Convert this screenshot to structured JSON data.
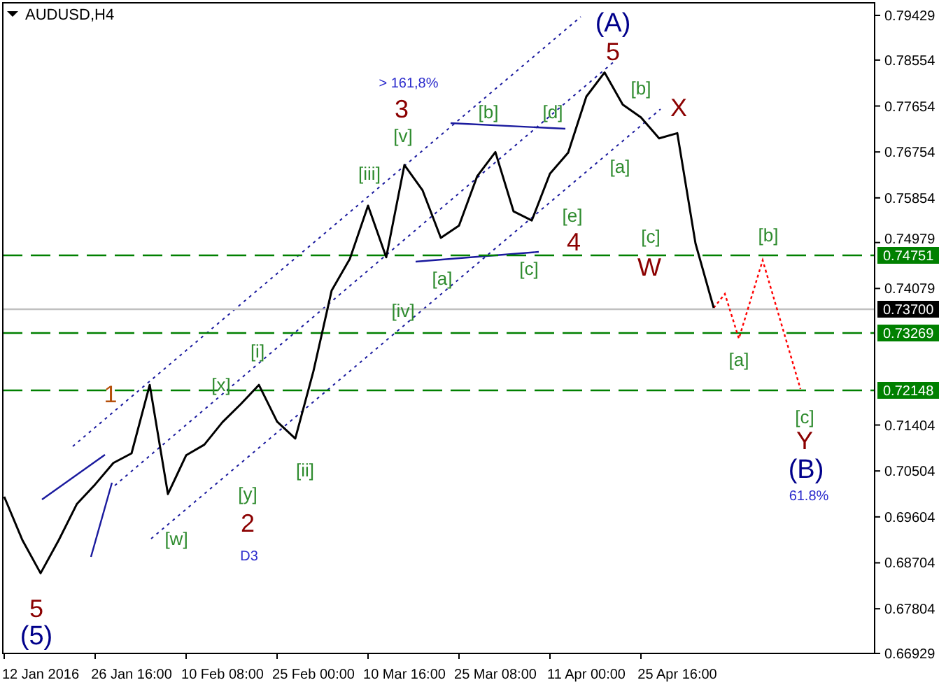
{
  "chart_data": {
    "type": "line",
    "title": "AUDUSD,H4",
    "ylim": [
      0.66929,
      0.79676
    ],
    "categories": [
      null,
      null,
      "12 Jan 2016",
      null,
      null,
      null,
      null,
      "26 Jan 16:00",
      null,
      null,
      null,
      null,
      "10 Feb 08:00",
      null,
      null,
      null,
      null,
      "25 Feb 00:00",
      null,
      null,
      null,
      null,
      "10 Mar 16:00",
      null,
      null,
      null,
      null,
      "25 Mar 08:00",
      null,
      null,
      null,
      null,
      "11 Apr 00:00",
      null,
      null,
      null,
      null,
      "25 Apr 16:00",
      null,
      null,
      null,
      null,
      null,
      null,
      null,
      null,
      null,
      null
    ],
    "series": [
      {
        "color": "#000000",
        "values": [
          0.7,
          0.6915,
          0.685,
          0.6915,
          0.6986,
          0.7024,
          0.7066,
          0.7085,
          0.7219,
          0.7005,
          0.7081,
          0.7102,
          0.7146,
          0.7181,
          0.7219,
          0.7147,
          0.7114,
          0.7246,
          0.7404,
          0.7466,
          0.757,
          0.7469,
          0.765,
          0.76,
          0.7507,
          0.7531,
          0.7628,
          0.7675,
          0.7559,
          0.7541,
          0.7633,
          0.7674,
          0.7784,
          0.7831,
          0.7768,
          0.7743,
          0.7702,
          0.7712,
          0.7496,
          0.737,
          null,
          null,
          null,
          null,
          null,
          null,
          null,
          null
        ]
      }
    ],
    "yticks": [
      {
        "value": 0.79429,
        "label": "0.79429"
      },
      {
        "value": 0.78554,
        "label": "0.78554"
      },
      {
        "value": 0.77654,
        "label": "0.77654"
      },
      {
        "value": 0.76754,
        "label": "0.76754"
      },
      {
        "value": 0.75854,
        "label": "0.75854"
      },
      {
        "value": 0.74979,
        "label": "0.74979"
      },
      {
        "value": 0.74079,
        "label": "0.74079"
      },
      {
        "value": 0.71404,
        "label": "0.71404"
      },
      {
        "value": 0.70504,
        "label": "0.70504"
      },
      {
        "value": 0.69604,
        "label": "0.69604"
      },
      {
        "value": 0.68704,
        "label": "0.68704"
      },
      {
        "value": 0.67804,
        "label": "0.67804"
      },
      {
        "value": 0.66929,
        "label": "0.66929"
      }
    ]
  },
  "price_levels": [
    {
      "kind": "level",
      "label": "0.74751"
    },
    {
      "kind": "current",
      "label": "0.73700"
    },
    {
      "kind": "level",
      "label": "0.73269"
    },
    {
      "kind": "level",
      "label": "0.72148"
    }
  ],
  "wave_labels": [
    {
      "kind": "degree",
      "text": "(A)"
    },
    {
      "kind": "major",
      "text": "5"
    },
    {
      "kind": "note",
      "text": "> 161,8%"
    },
    {
      "kind": "minor",
      "text": "[b]"
    },
    {
      "kind": "major",
      "text": "3"
    },
    {
      "kind": "minor",
      "text": "[b]"
    },
    {
      "kind": "minor",
      "text": "[d]"
    },
    {
      "kind": "major",
      "text": "X"
    },
    {
      "kind": "minor",
      "text": "[v]"
    },
    {
      "kind": "minor",
      "text": "[iii]"
    },
    {
      "kind": "minor",
      "text": "[a]"
    },
    {
      "kind": "minor",
      "text": "[e]"
    },
    {
      "kind": "major",
      "text": "4"
    },
    {
      "kind": "minor",
      "text": "[c]"
    },
    {
      "kind": "minor",
      "text": "[b]"
    },
    {
      "kind": "minor",
      "text": "[a]"
    },
    {
      "kind": "minor",
      "text": "[c]"
    },
    {
      "kind": "major",
      "text": "W"
    },
    {
      "kind": "minor",
      "text": "[iv]"
    },
    {
      "kind": "minor",
      "text": "[i]"
    },
    {
      "kind": "minor",
      "text": "[a]"
    },
    {
      "kind": "intermediate",
      "text": "1"
    },
    {
      "kind": "minor",
      "text": "[x]"
    },
    {
      "kind": "minor",
      "text": "[c]"
    },
    {
      "kind": "major",
      "text": "Y"
    },
    {
      "kind": "minor",
      "text": "[ii]"
    },
    {
      "kind": "degree",
      "text": "(B)"
    },
    {
      "kind": "minor",
      "text": "[y]"
    },
    {
      "kind": "note",
      "text": "61.8%"
    },
    {
      "kind": "minor",
      "text": "[w]"
    },
    {
      "kind": "major",
      "text": "2"
    },
    {
      "kind": "note",
      "text": "D3"
    },
    {
      "kind": "major",
      "text": "5"
    },
    {
      "kind": "degree",
      "text": "(5)"
    }
  ]
}
